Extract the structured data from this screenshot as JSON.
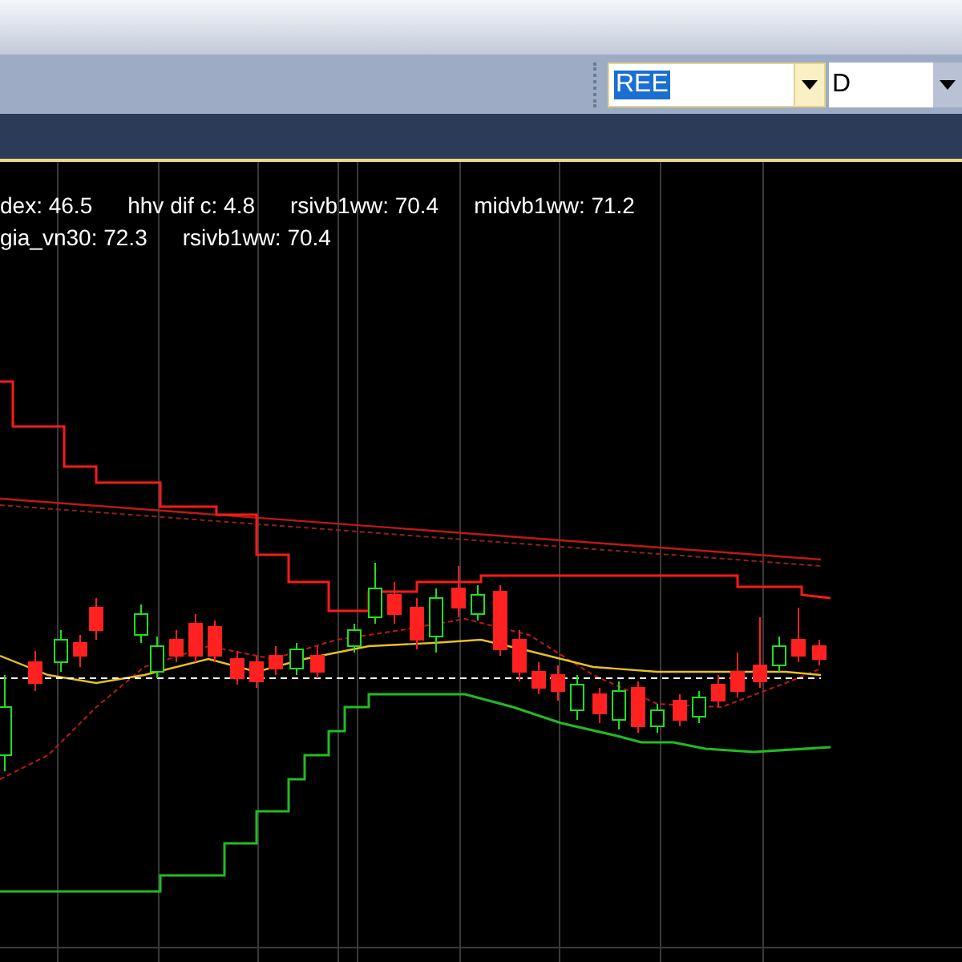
{
  "toolbar": {
    "symbol_field": {
      "value": "REE",
      "selected": true
    },
    "period_field": {
      "value": "D"
    }
  },
  "indicators": [
    [
      "dex: 46.5",
      "hhv dif c: 4.8",
      "rsivb1ww: 70.4",
      "midvb1ww: 71.2"
    ],
    [
      "gia_vn30: 72.3",
      "rsivb1ww: 70.4"
    ]
  ]
}
